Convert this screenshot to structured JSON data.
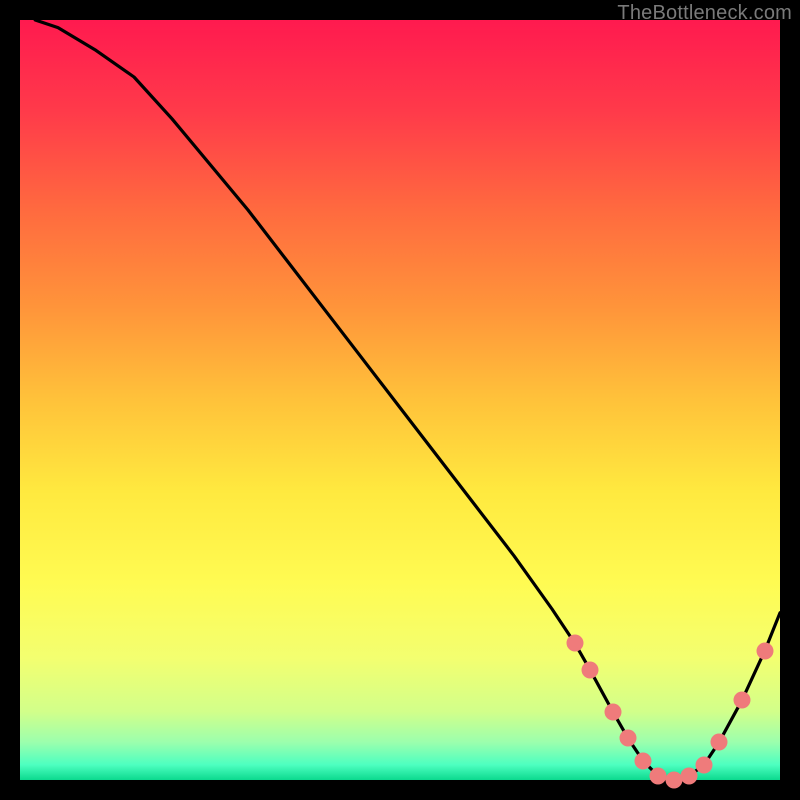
{
  "watermark": "TheBottleneck.com",
  "chart_data": {
    "type": "line",
    "title": "",
    "xlabel": "",
    "ylabel": "",
    "xlim": [
      0,
      100
    ],
    "ylim": [
      0,
      100
    ],
    "curve": {
      "name": "curve",
      "x": [
        2,
        5,
        10,
        15,
        20,
        25,
        30,
        35,
        40,
        45,
        50,
        55,
        60,
        65,
        70,
        73,
        75,
        78,
        80,
        82,
        84,
        86,
        88,
        90,
        92,
        95,
        98,
        100
      ],
      "y": [
        100,
        99,
        96,
        92.5,
        87,
        81,
        75,
        68.5,
        62,
        55.5,
        49,
        42.5,
        36,
        29.5,
        22.5,
        18,
        14.5,
        9,
        5.5,
        2.5,
        0.5,
        0,
        0.5,
        2,
        5,
        10.5,
        17,
        22
      ]
    },
    "markers": {
      "name": "dots",
      "color": "#ef7b7b",
      "x": [
        73,
        75,
        78,
        80,
        82,
        84,
        86,
        88,
        90,
        92,
        95,
        98
      ],
      "y": [
        18,
        14.5,
        9,
        5.5,
        2.5,
        0.5,
        0,
        0.5,
        2,
        5,
        10.5,
        17
      ]
    },
    "gradient_stops": [
      {
        "offset": 0,
        "color": "#ff1a4f"
      },
      {
        "offset": 12,
        "color": "#ff3a4a"
      },
      {
        "offset": 25,
        "color": "#ff6a3f"
      },
      {
        "offset": 38,
        "color": "#ff953a"
      },
      {
        "offset": 50,
        "color": "#ffc23a"
      },
      {
        "offset": 62,
        "color": "#ffe93f"
      },
      {
        "offset": 74,
        "color": "#fffb52"
      },
      {
        "offset": 84,
        "color": "#f3ff70"
      },
      {
        "offset": 91,
        "color": "#d2ff8a"
      },
      {
        "offset": 95,
        "color": "#9cffad"
      },
      {
        "offset": 98,
        "color": "#4dffc0"
      },
      {
        "offset": 100,
        "color": "#0cd98e"
      }
    ]
  }
}
